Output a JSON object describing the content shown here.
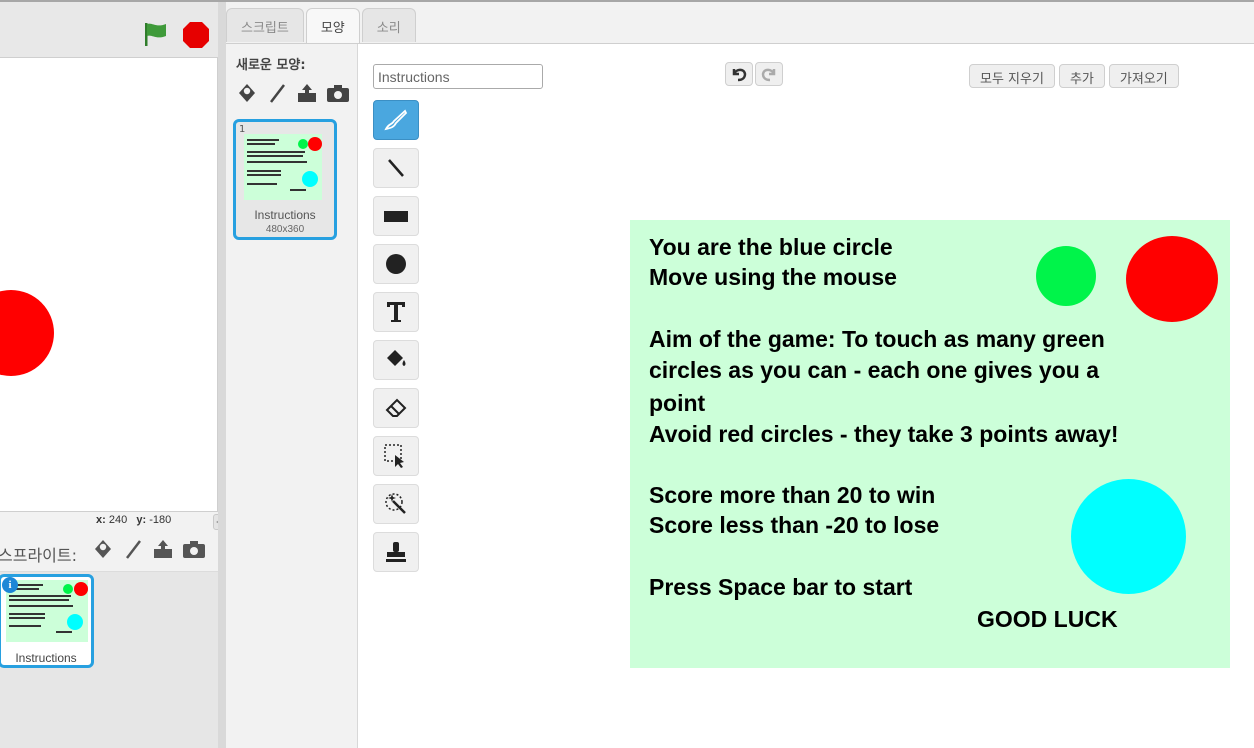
{
  "stage": {
    "coords": {
      "x_label": "x:",
      "x_value": "240",
      "y_label": "y:",
      "y_value": "-180"
    }
  },
  "sprites": {
    "label": "스프라이트:",
    "items": [
      {
        "name": "Instructions"
      }
    ]
  },
  "tabs": [
    {
      "label": "스크립트"
    },
    {
      "label": "모양"
    },
    {
      "label": "소리"
    }
  ],
  "costumes": {
    "new_label": "새로운 모양:",
    "items": [
      {
        "number": "1",
        "name": "Instructions",
        "size": "480x360"
      }
    ]
  },
  "editor": {
    "costume_name": "Instructions",
    "buttons": {
      "clear": "모두 지우기",
      "add": "추가",
      "import": "가져오기"
    },
    "canvas_text": {
      "line1": "You are the blue circle",
      "line2": "Move using the mouse",
      "line3": "Aim of the game: To touch as many green",
      "line4": "circles as you can - each one gives you a",
      "line5": "point",
      "line6": "Avoid red circles - they take 3 points away!",
      "line7": "Score more than 20 to win",
      "line8": "Score less than -20 to lose",
      "line9": "Press Space bar to start",
      "line10": "GOOD LUCK"
    }
  },
  "colors": {
    "accent": "#27a0e0",
    "canvas_bg": "#ccffd9",
    "green_circle": "#00f44a",
    "red_circle": "#ff0000",
    "cyan_circle": "#00ffff"
  }
}
